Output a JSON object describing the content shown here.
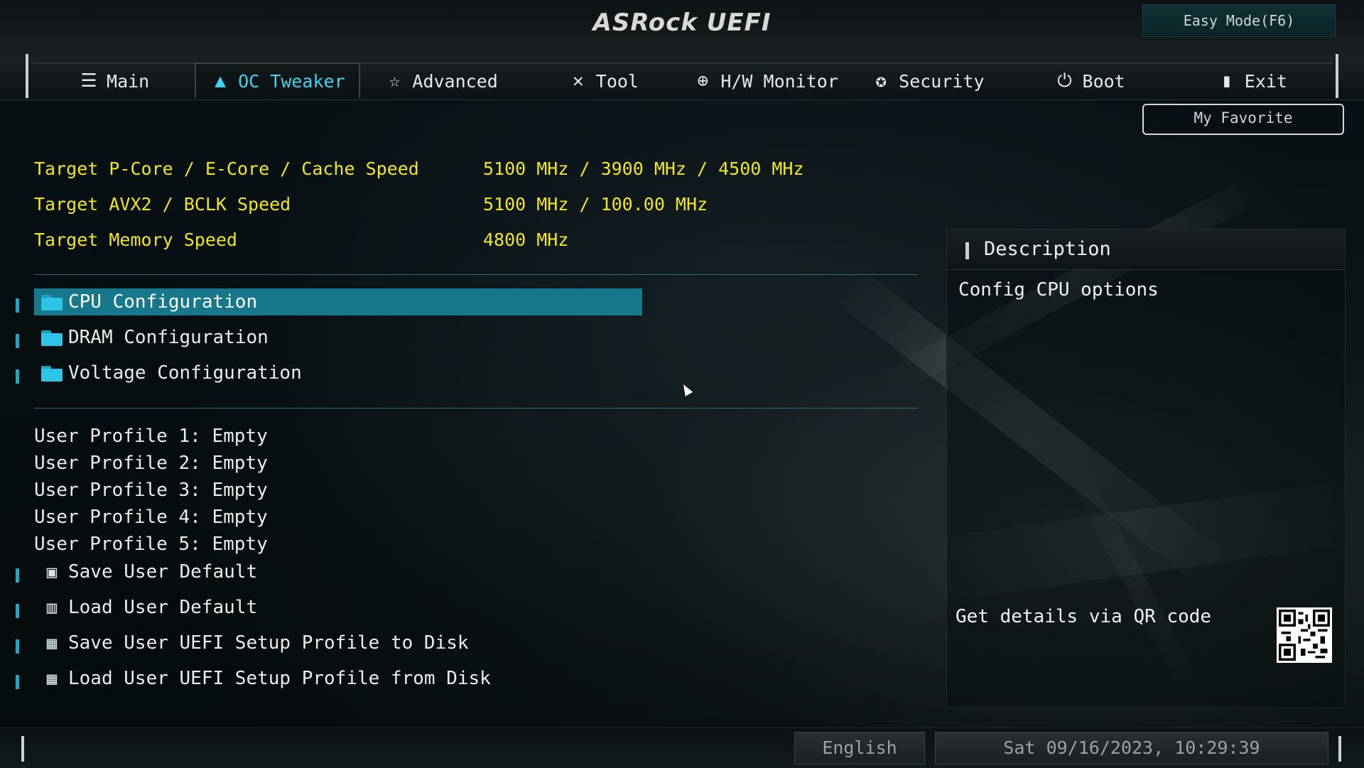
{
  "header": {
    "logo": "ASRock UEFI",
    "easy_mode": "Easy Mode(F6)",
    "my_favorite": "My Favorite"
  },
  "tabs": [
    {
      "label": "Main",
      "icon": "list-icon"
    },
    {
      "label": "OC Tweaker",
      "icon": "rocket-icon",
      "active": true
    },
    {
      "label": "Advanced",
      "icon": "star-icon"
    },
    {
      "label": "Tool",
      "icon": "tools-icon"
    },
    {
      "label": "H/W Monitor",
      "icon": "monitor-icon"
    },
    {
      "label": "Security",
      "icon": "shield-icon"
    },
    {
      "label": "Boot",
      "icon": "power-icon"
    },
    {
      "label": "Exit",
      "icon": "exit-icon"
    }
  ],
  "targets": [
    {
      "label": "Target P-Core / E-Core / Cache Speed",
      "value": "5100 MHz / 3900 MHz / 4500 MHz"
    },
    {
      "label": "Target AVX2 / BCLK Speed",
      "value": "5100 MHz / 100.00 MHz"
    },
    {
      "label": "Target Memory Speed",
      "value": "4800 MHz"
    }
  ],
  "config_items": [
    {
      "label": "CPU Configuration",
      "selected": true
    },
    {
      "label": "DRAM Configuration"
    },
    {
      "label": "Voltage Configuration"
    }
  ],
  "profiles": [
    "User Profile 1: Empty",
    "User Profile 2: Empty",
    "User Profile 3: Empty",
    "User Profile 4: Empty",
    "User Profile 5: Empty"
  ],
  "actions": [
    {
      "label": "Save User Default",
      "icon": "save-icon"
    },
    {
      "label": "Load User Default",
      "icon": "book-icon"
    },
    {
      "label": "Save User UEFI Setup Profile to Disk",
      "icon": "disk-save-icon"
    },
    {
      "label": "Load User UEFI Setup Profile from Disk",
      "icon": "disk-load-icon"
    }
  ],
  "description": {
    "title": "Description",
    "text": "Config CPU options",
    "qr_label": "Get details via QR code"
  },
  "footer": {
    "language": "English",
    "datetime": "Sat 09/16/2023, 10:29:39"
  },
  "colors": {
    "accent": "#3fd2f2",
    "highlight": "#16788a",
    "target_text": "#f2e61a"
  }
}
